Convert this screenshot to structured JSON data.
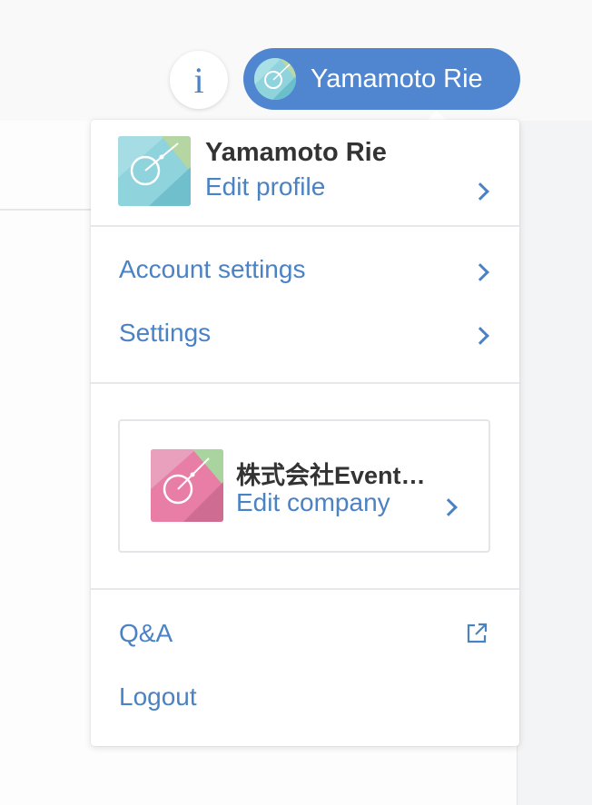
{
  "header": {
    "info_button_glyph": "i",
    "user_name": "Yamamoto Rie",
    "accent_color": "#4f86cf"
  },
  "menu": {
    "profile": {
      "name": "Yamamoto Rie",
      "edit_label": "Edit profile"
    },
    "items": [
      {
        "label": "Account settings"
      },
      {
        "label": "Settings"
      }
    ],
    "company": {
      "name": "株式会社Event…",
      "edit_label": "Edit company"
    },
    "footer_items": [
      {
        "label": "Q&A",
        "icon": "external-link-icon"
      },
      {
        "label": "Logout"
      }
    ],
    "link_color": "#4a82c4"
  }
}
